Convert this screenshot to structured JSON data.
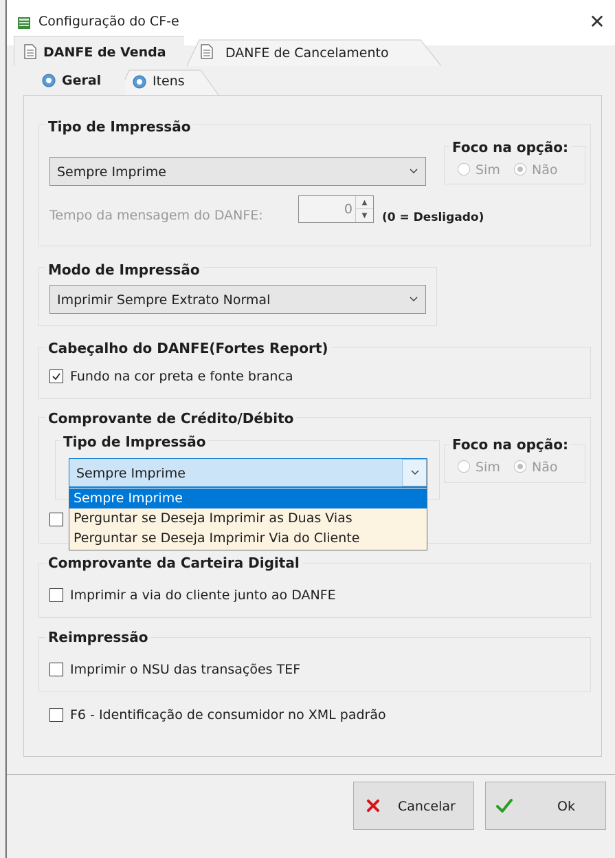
{
  "window": {
    "title": "Configuração do CF-e",
    "close_glyph": "✕"
  },
  "tabs": {
    "main": [
      {
        "label": "DANFE de Venda",
        "icon": "document-icon"
      },
      {
        "label": "DANFE de Cancelamento",
        "icon": "document-icon"
      }
    ],
    "sub": [
      {
        "label": "Geral",
        "icon": "gear-icon"
      },
      {
        "label": "Itens",
        "icon": "gear-icon"
      }
    ]
  },
  "tipo_impressao": {
    "title": "Tipo de Impressão",
    "selected": "Sempre Imprime",
    "foco": {
      "title": "Foco na opção:",
      "sim": "Sim",
      "nao": "Não",
      "selected": "Não"
    },
    "tempo_label": "Tempo da mensagem do DANFE:",
    "tempo_value": "0",
    "tempo_hint": "(0 = Desligado)"
  },
  "modo_impressao": {
    "title": "Modo de Impressão",
    "selected": "Imprimir Sempre Extrato Normal"
  },
  "cabecalho": {
    "title": "Cabeçalho do DANFE(Fortes Report)",
    "checkbox_label": "Fundo na cor preta e fonte branca",
    "checked": true
  },
  "comprovante_credito": {
    "title": "Comprovante de Crédito/Débito",
    "tipo_title": "Tipo de Impressão",
    "selected": "Sempre Imprime",
    "options": [
      "Sempre Imprime",
      "Perguntar se Deseja Imprimir as Duas Vias",
      "Perguntar se Deseja Imprimir Via do Cliente"
    ],
    "foco": {
      "title": "Foco na opção:",
      "sim": "Sim",
      "nao": "Não",
      "selected": "Não"
    },
    "checked": false
  },
  "carteira_digital": {
    "title": "Comprovante da Carteira Digital",
    "checkbox_label": "Imprimir a via do cliente junto ao DANFE",
    "checked": false
  },
  "reimpressao": {
    "title": "Reimpressão",
    "checkbox_label": "Imprimir o NSU das transações TEF",
    "checked": false
  },
  "f6": {
    "checkbox_label": "F6 - Identificação de consumidor no XML padrão",
    "checked": false
  },
  "buttons": {
    "cancel": "Cancelar",
    "ok": "Ok",
    "cancel_color": "#d7141a",
    "ok_color": "#2e9b26"
  }
}
